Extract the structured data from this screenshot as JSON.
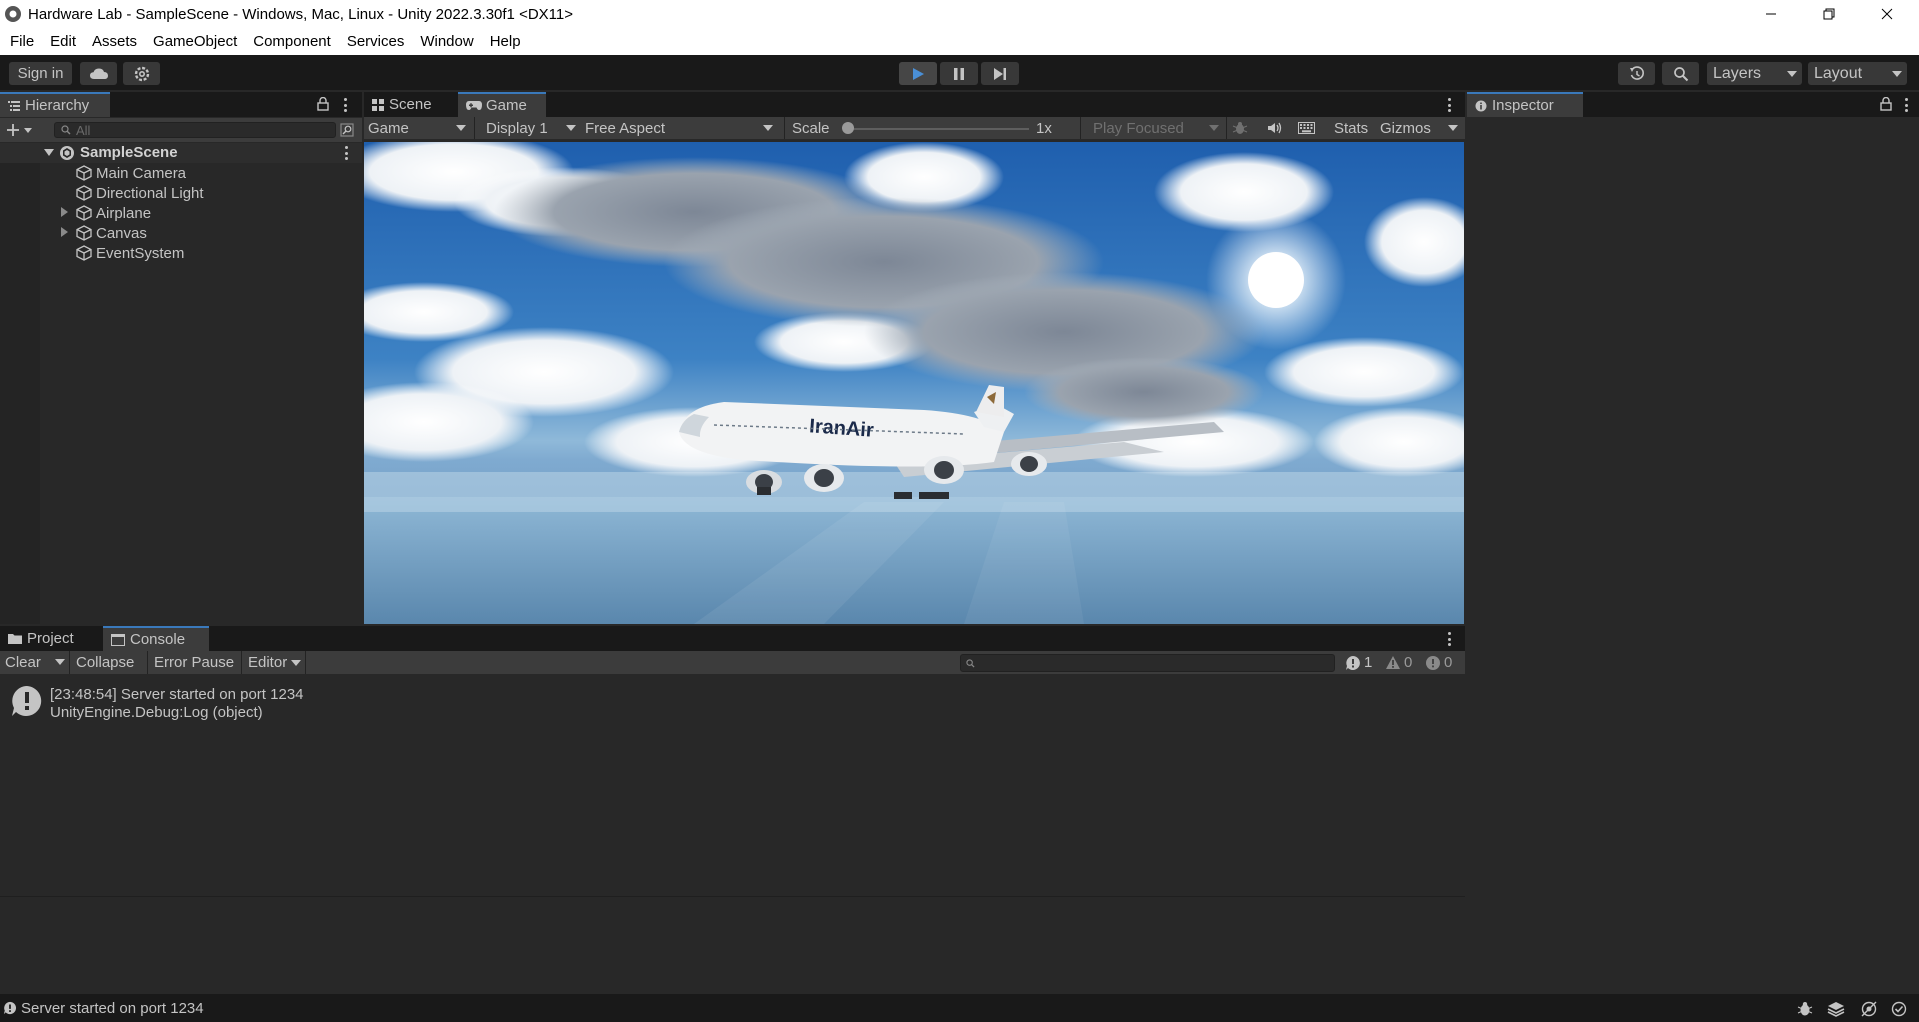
{
  "window": {
    "title": "Hardware Lab - SampleScene - Windows, Mac, Linux - Unity 2022.3.30f1 <DX11>"
  },
  "menu": [
    "File",
    "Edit",
    "Assets",
    "GameObject",
    "Component",
    "Services",
    "Window",
    "Help"
  ],
  "toolbar": {
    "sign_in": "Sign in",
    "layers": "Layers",
    "layout": "Layout"
  },
  "hierarchy": {
    "tab_label": "Hierarchy",
    "search_placeholder": "All",
    "scene_name": "SampleScene",
    "items": [
      {
        "label": "Main Camera",
        "has_children": false
      },
      {
        "label": "Directional Light",
        "has_children": false
      },
      {
        "label": "Airplane",
        "has_children": true
      },
      {
        "label": "Canvas",
        "has_children": true
      },
      {
        "label": "EventSystem",
        "has_children": false
      }
    ]
  },
  "view_tabs": {
    "scene": "Scene",
    "game": "Game"
  },
  "game_toolbar": {
    "view_mode": "Game",
    "display": "Display 1",
    "aspect": "Free Aspect",
    "scale_label": "Scale",
    "scale_value": "1x",
    "play_mode": "Play Focused",
    "stats": "Stats",
    "gizmos": "Gizmos"
  },
  "game_view": {
    "aircraft_livery": "IranAir"
  },
  "inspector": {
    "tab_label": "Inspector"
  },
  "bottom_tabs": {
    "project": "Project",
    "console": "Console"
  },
  "console": {
    "clear": "Clear",
    "collapse": "Collapse",
    "error_pause": "Error Pause",
    "editor": "Editor",
    "counts": {
      "log": "1",
      "warning": "0",
      "error": "0"
    },
    "entries": [
      {
        "line1": "[23:48:54] Server started on port 1234",
        "line2": "UnityEngine.Debug:Log (object)"
      }
    ]
  },
  "status_bar": {
    "message": "Server started on port 1234"
  },
  "colors": {
    "accent": "#3a79bb",
    "play_active": "#4a8fd6"
  }
}
